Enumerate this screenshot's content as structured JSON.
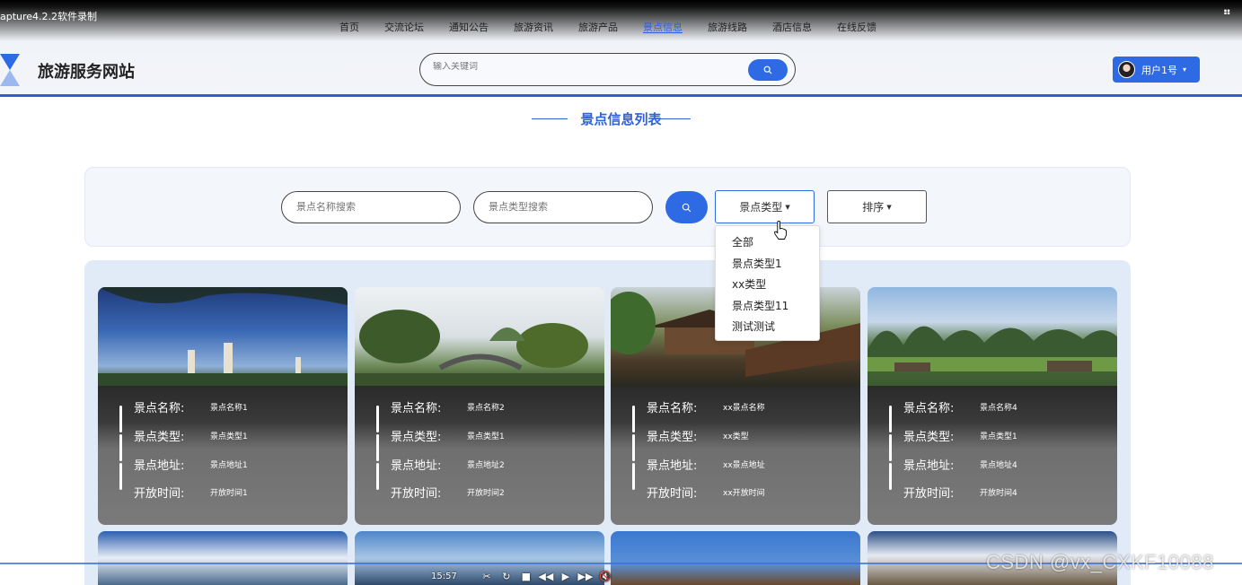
{
  "recorder": {
    "title": "apture4.2.2软件录制"
  },
  "nav": {
    "items": [
      "首页",
      "交流论坛",
      "通知公告",
      "旅游资讯",
      "旅游产品",
      "景点信息",
      "旅游线路",
      "酒店信息",
      "在线反馈"
    ],
    "active_index": 5
  },
  "site": {
    "title": "旅游服务网站"
  },
  "search": {
    "placeholder": "输入关键词"
  },
  "user": {
    "label": "用户1号"
  },
  "section": {
    "title": "景点信息列表"
  },
  "filters": {
    "name_placeholder": "景点名称搜索",
    "type_placeholder": "景点类型搜索",
    "type_dropdown_label": "景点类型",
    "sort_label": "排序",
    "type_options": [
      "全部",
      "景点类型1",
      "xx类型",
      "景点类型11",
      "测试测试"
    ]
  },
  "cards": [
    {
      "labels": [
        "景点名称:",
        "景点类型:",
        "景点地址:",
        "开放时间:"
      ],
      "values": [
        "景点名称1",
        "景点类型1",
        "景点地址1",
        "开放时间1"
      ]
    },
    {
      "labels": [
        "景点名称:",
        "景点类型:",
        "景点地址:",
        "开放时间:"
      ],
      "values": [
        "景点名称2",
        "景点类型1",
        "景点地址2",
        "开放时间2"
      ]
    },
    {
      "labels": [
        "景点名称:",
        "景点类型:",
        "景点地址:",
        "开放时间:"
      ],
      "values": [
        "xx景点名称",
        "xx类型",
        "xx景点地址",
        "xx开放时间"
      ]
    },
    {
      "labels": [
        "景点名称:",
        "景点类型:",
        "景点地址:",
        "开放时间:"
      ],
      "values": [
        "景点名称4",
        "景点类型1",
        "景点地址4",
        "开放时间4"
      ]
    }
  ],
  "player": {
    "time": "15:57"
  },
  "watermark": "CSDN @vx_CXKF10088",
  "colors": {
    "accent": "#2d6ae3",
    "title_blue": "#2f63d9"
  }
}
